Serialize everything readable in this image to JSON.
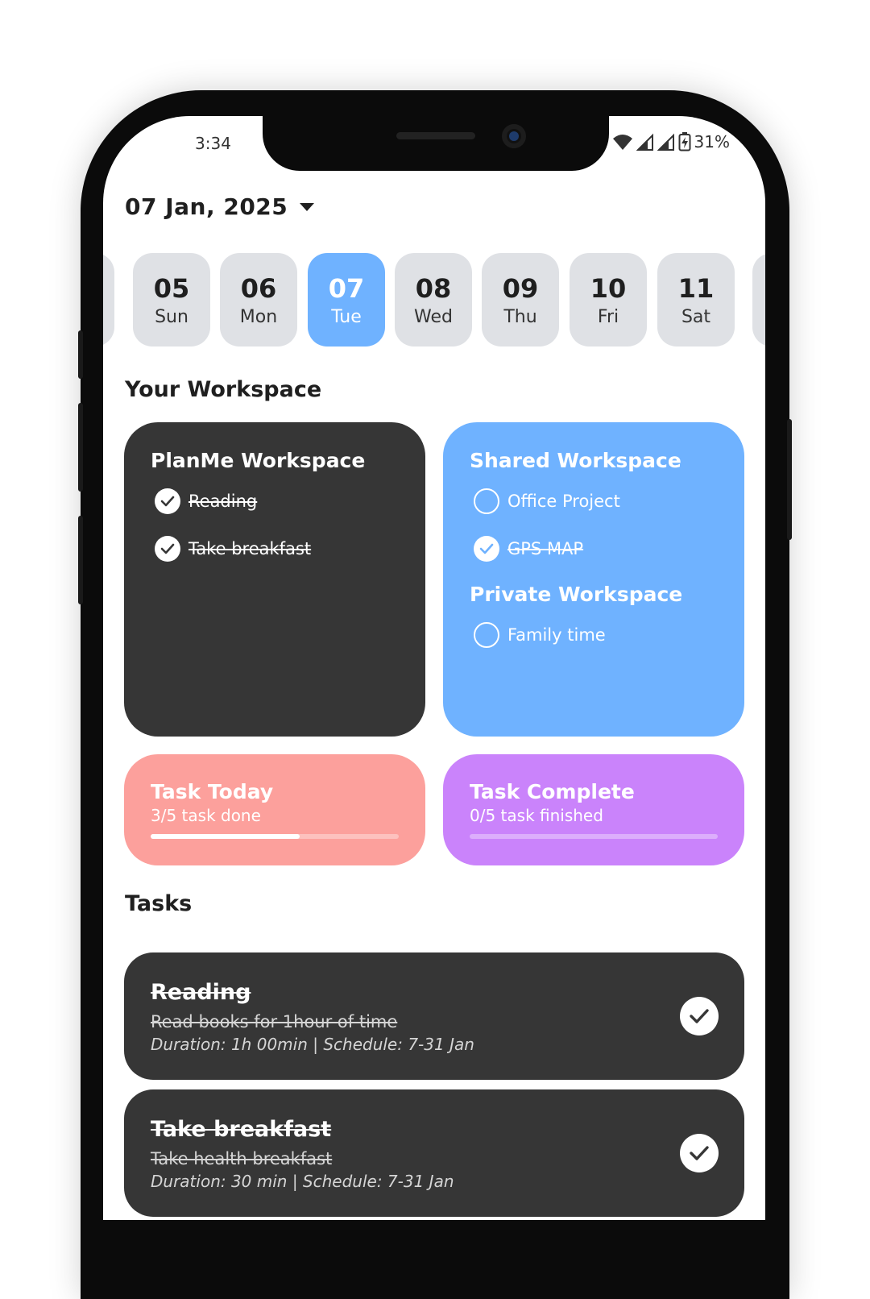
{
  "status_bar": {
    "time": "3:34",
    "battery": "31%"
  },
  "date_picker": {
    "title": "07 Jan, 2025"
  },
  "days": [
    {
      "num": "05",
      "name": "Sun",
      "active": false
    },
    {
      "num": "06",
      "name": "Mon",
      "active": false
    },
    {
      "num": "07",
      "name": "Tue",
      "active": true
    },
    {
      "num": "08",
      "name": "Wed",
      "active": false
    },
    {
      "num": "09",
      "name": "Thu",
      "active": false
    },
    {
      "num": "10",
      "name": "Fri",
      "active": false
    },
    {
      "num": "11",
      "name": "Sat",
      "active": false
    }
  ],
  "workspace_section": {
    "title": "Your Workspace"
  },
  "planme_workspace": {
    "title": "PlanMe Workspace",
    "tasks": [
      {
        "label": "Reading",
        "done": true
      },
      {
        "label": "Take breakfast",
        "done": true
      }
    ]
  },
  "shared_workspace": {
    "title": "Shared Workspace",
    "tasks": [
      {
        "label": "Office Project",
        "done": false
      },
      {
        "label": "GPS MAP",
        "done": true
      }
    ]
  },
  "private_workspace": {
    "title": "Private Workspace",
    "tasks": [
      {
        "label": "Family time",
        "done": false
      }
    ]
  },
  "task_today": {
    "title": "Task Today",
    "subtitle": "3/5 task done",
    "progress": 0.6
  },
  "task_complete": {
    "title": "Task Complete",
    "subtitle": "0/5 task finished",
    "progress": 0.0
  },
  "tasks_section": {
    "title": "Tasks"
  },
  "tasks": [
    {
      "title": "Reading",
      "description": "Read books for 1hour of time",
      "meta": "Duration: 1h 00min | Schedule: 7-31 Jan",
      "done": true
    },
    {
      "title": "Take breakfast",
      "description": "Take health breakfast",
      "meta": "Duration: 30 min | Schedule: 7-31 Jan",
      "done": true
    }
  ],
  "colors": {
    "accent_blue": "#6fb2ff",
    "dark_card": "#363636",
    "pink_card": "#fca09c",
    "purple_card": "#ca83fb",
    "chip_gray": "#dfe1e5"
  }
}
